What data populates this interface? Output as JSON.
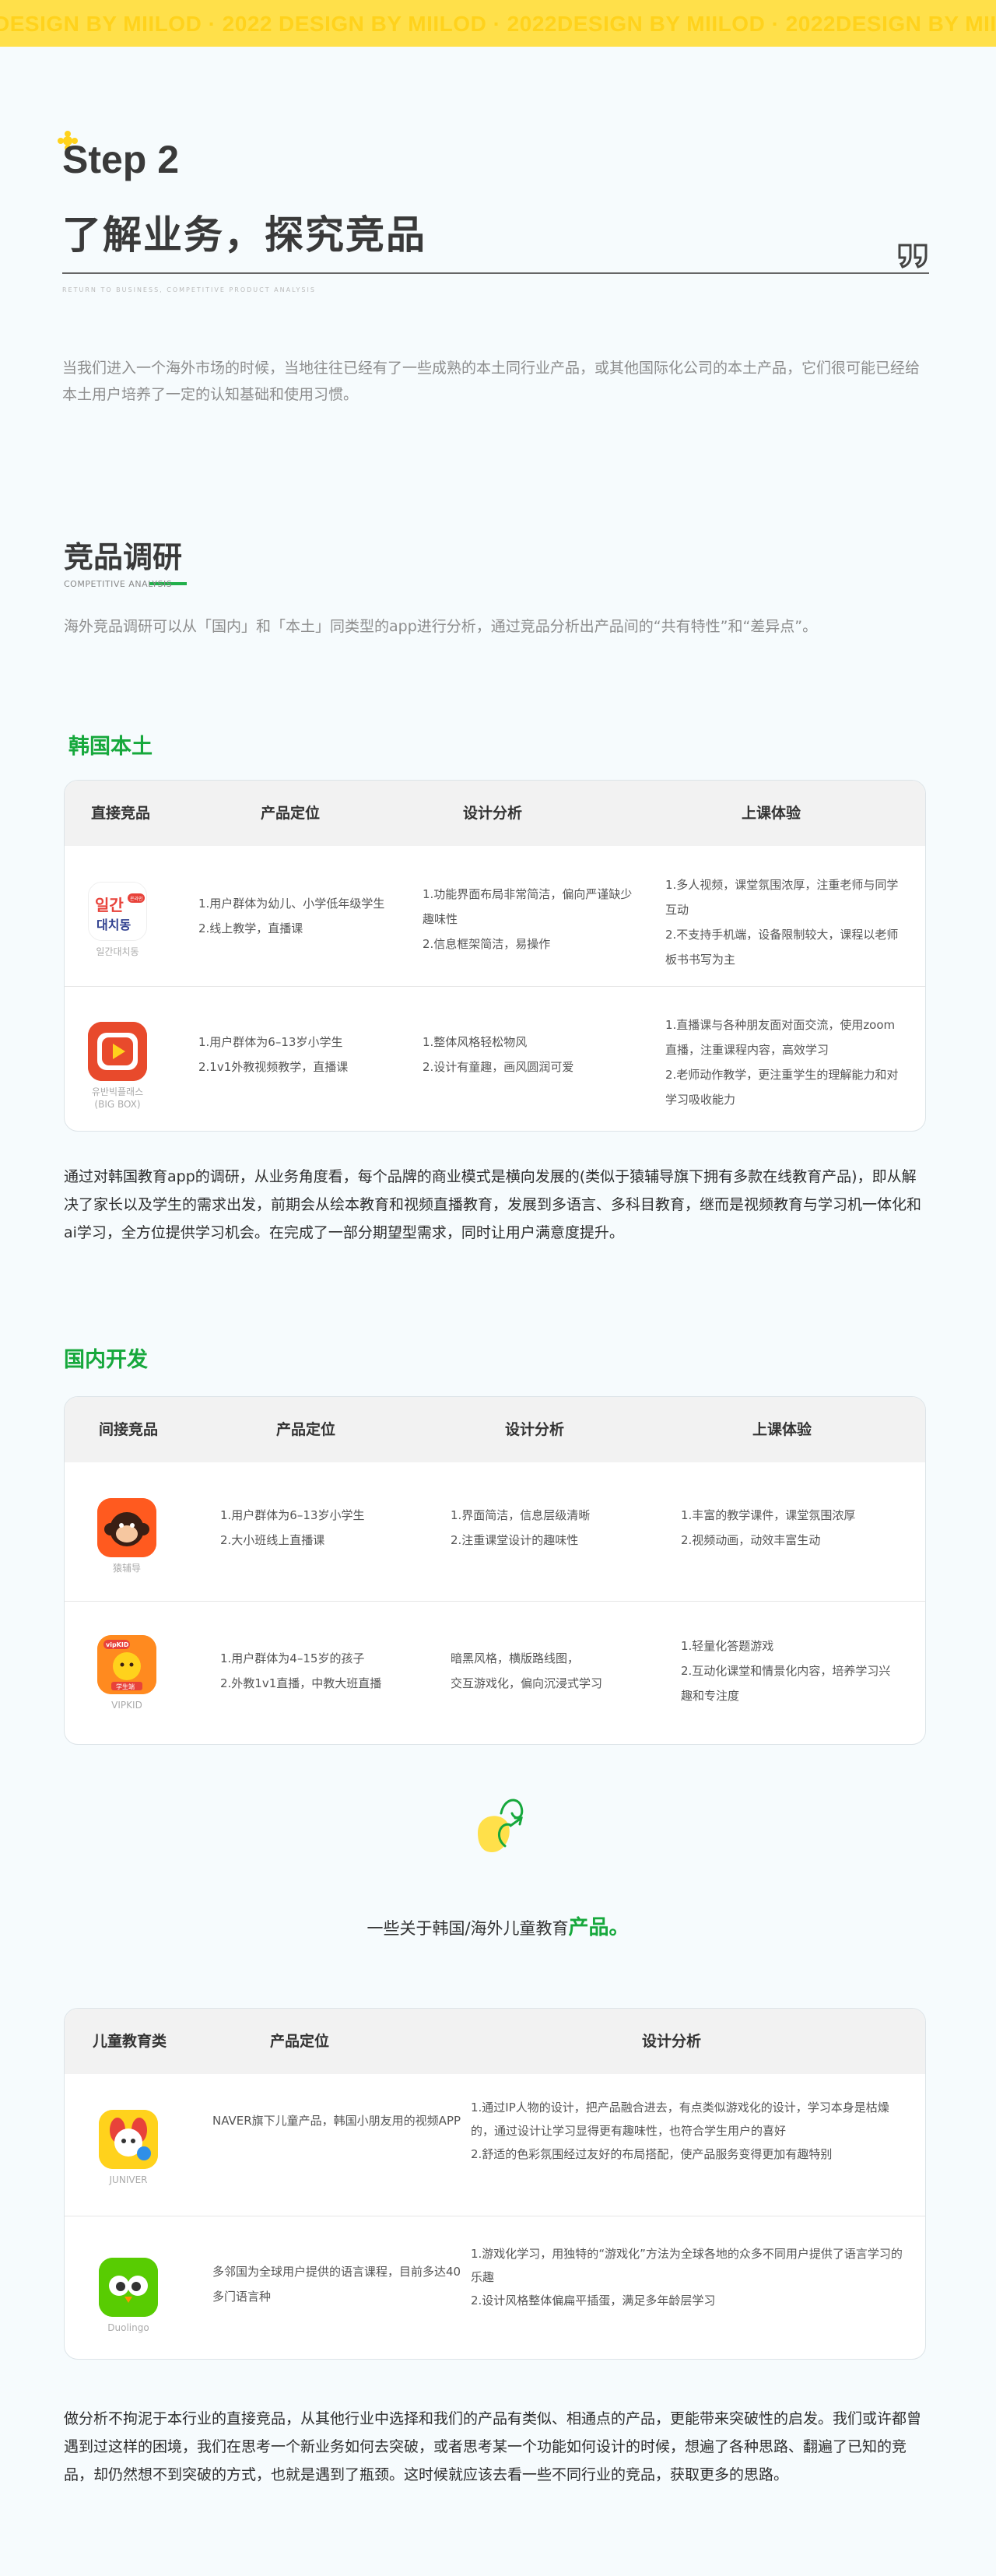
{
  "banner": {
    "text": "DESIGN BY MIILOD · 2022"
  },
  "header": {
    "step": "Step 2",
    "title": "了解业务，探究竞品",
    "subtitle_en": "RETURN TO BUSINESS, COMPETITIVE PRODUCT ANALYSIS",
    "quote_glyph": "”"
  },
  "intro": "当我们进入一个海外市场的时候，当地往往已经有了一些成熟的本土同行业产品，或其他国际化公司的本土产品，它们很可能已经给本土用户培养了一定的认知基础和使用习惯。",
  "research": {
    "title": "竞品调研",
    "subtitle_en": "COMPETITIVE ANALYSIS",
    "desc": "海外竞品调研可以从「国内」和「本土」同类型的app进行分析，通过竞品分析出产品间的“共有特性”和“差异点”。"
  },
  "korea": {
    "title": "韩国本土",
    "headers": [
      "直接竞品",
      "产品定位",
      "设计分析",
      "上课体验"
    ],
    "rows": [
      {
        "app": "일간대치동",
        "badge": "온라인",
        "icon_text": "일간\n대치동",
        "position": [
          "1.用户群体为幼儿、小学低年级学生",
          "2.线上教学，直播课"
        ],
        "design": [
          "1.功能界面布局非常简洁，偏向严谨缺少趣味性",
          "2.信息框架简洁，易操作"
        ],
        "experience": [
          "1.多人视频，课堂氛围浓厚，注重老师与同学互动",
          "2.不支持手机端，设备限制较大，课程以老师板书书写为主"
        ]
      },
      {
        "app": "유반빅플래스\n(BIG BOX)",
        "position": [
          "1.用户群体为6–13岁小学生",
          "2.1v1外教视频教学，直播课"
        ],
        "design": [
          "1.整体风格轻松物风",
          "2.设计有童趣，画风圆润可爱"
        ],
        "experience": [
          "1.直播课与各种朋友面对面交流，使用zoom直播，注重课程内容，高效学习",
          "2.老师动作教学，更注重学生的理解能力和对学习吸收能力"
        ]
      }
    ]
  },
  "korea_summary": "通过对韩国教育app的调研，从业务角度看，每个品牌的商业模式是横向发展的(类似于猿辅导旗下拥有多款在线教育产品)，即从解决了家长以及学生的需求出发，前期会从绘本教育和视频直播教育，发展到多语言、多科目教育，继而是视频教育与学习机一体化和ai学习，全方位提供学习机会。在完成了一部分期望型需求，同时让用户满意度提升。",
  "domestic": {
    "title": "国内开发",
    "headers": [
      "间接竞品",
      "产品定位",
      "设计分析",
      "上课体验"
    ],
    "rows": [
      {
        "app": "猿辅导",
        "position": [
          "1.用户群体为6–13岁小学生",
          "2.大小班线上直播课"
        ],
        "design": [
          "1.界面简洁，信息层级清晰",
          "2.注重课堂设计的趣味性"
        ],
        "experience": [
          "1.丰富的教学课件，课堂氛围浓厚",
          "2.视频动画，动效丰富生动"
        ]
      },
      {
        "app": "VIPKID",
        "icon_badge": "vipKID",
        "icon_sub": "学生端",
        "position": [
          "1.用户群体为4–15岁的孩子",
          "2.外教1v1直播，中教大班直播"
        ],
        "design": [
          "暗黑风格，横版路线图，",
          "交互游戏化，偏向沉浸式学习"
        ],
        "experience": [
          "1.轻量化答题游戏",
          "2.互动化课堂和情景化内容，培养学习兴趣和专注度"
        ]
      }
    ]
  },
  "caption": {
    "prefix": "一些关于韩国/海外儿童教育",
    "highlight": "产品。"
  },
  "kids": {
    "headers": [
      "儿童教育类",
      "产品定位",
      "设计分析"
    ],
    "rows": [
      {
        "app": "JUNIVER",
        "position": "NAVER旗下儿童产品，韩国小朋友用的视频APP",
        "design": [
          "1.通过IP人物的设计，把产品融合进去，有点类似游戏化的设计，学习本身是枯燥的，通过设计让学习显得更有趣味性，也符合学生用户的喜好",
          "2.舒适的色彩氛围经过友好的布局搭配，使产品服务变得更加有趣特别"
        ]
      },
      {
        "app": "Duolingo",
        "position": "多邻国为全球用户提供的语言课程，目前多达40多门语言种",
        "design": [
          "1.游戏化学习，用独特的“游戏化”方法为全球各地的众多不同用户提供了语言学习的乐趣",
          "2.设计风格整体偏扁平插蛋，满足多年龄层学习"
        ]
      }
    ]
  },
  "footer_text": "做分析不拘泥于本行业的直接竞品，从其他行业中选择和我们的产品有类似、相通点的产品，更能带来突破性的启发。我们或许都曾遇到过这样的困境，我们在思考一个新业务如何去突破，或者思考某一个功能如何设计的时候，想遍了各种思路、翻遍了已知的竞品，却仍然想不到突破的方式，也就是遇到了瓶颈。这时候就应该去看一些不同行业的竞品，获取更多的思路。",
  "colors": {
    "accent_green": "#16a83c",
    "banner_yellow": "#ffe04a"
  }
}
